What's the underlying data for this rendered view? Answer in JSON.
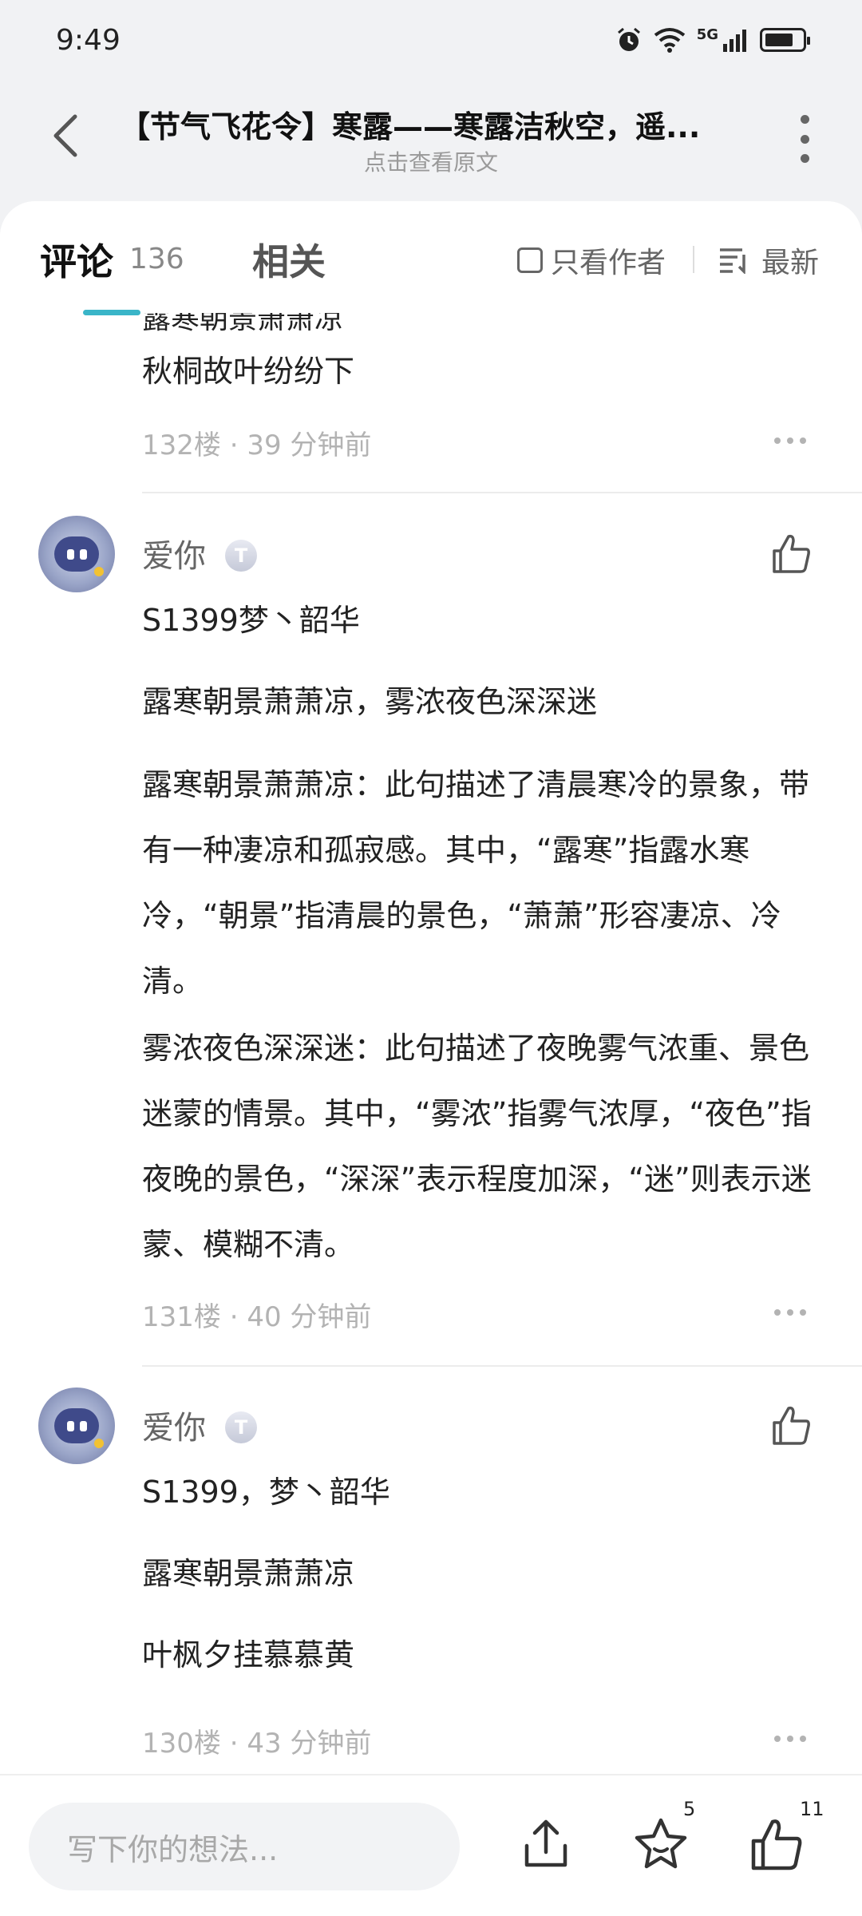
{
  "status": {
    "time": "9:49",
    "network": "5G"
  },
  "header": {
    "title": "【节气飞花令】寒露——寒露洁秋空，遥...",
    "subtitle": "点击查看原文"
  },
  "tabs": {
    "comments_label": "评论",
    "comments_count": "136",
    "related_label": "相关",
    "author_only_label": "只看作者",
    "sort_label": "最新"
  },
  "comments": [
    {
      "partial_line": "露寒朝景萧萧凉",
      "lines": [
        "秋桐故叶纷纷下"
      ],
      "meta": "132楼 · 39 分钟前"
    },
    {
      "user": "爱你",
      "badge": "T",
      "lines": [
        "S1399梦丶韶华",
        "露寒朝景萧萧凉，雾浓夜色深深迷",
        "露寒朝景萧萧凉：此句描述了清晨寒冷的景象，带有一种凄凉和孤寂感。其中，“露寒”指露水寒冷，“朝景”指清晨的景色，“萧萧”形容凄凉、冷清。",
        "雾浓夜色深深迷：此句描述了夜晚雾气浓重、景色迷蒙的情景。其中，“雾浓”指雾气浓厚，“夜色”指夜晚的景色，“深深”表示程度加深，“迷”则表示迷蒙、模糊不清。"
      ],
      "meta": "131楼 · 40 分钟前"
    },
    {
      "user": "爱你",
      "badge": "T",
      "lines": [
        "S1399，梦丶韶华",
        "露寒朝景萧萧凉",
        "叶枫夕挂慕慕黄"
      ],
      "meta": "130楼 · 43 分钟前"
    }
  ],
  "bottom": {
    "input_placeholder": "写下你的想法...",
    "star_count": "5",
    "like_count": "11"
  }
}
